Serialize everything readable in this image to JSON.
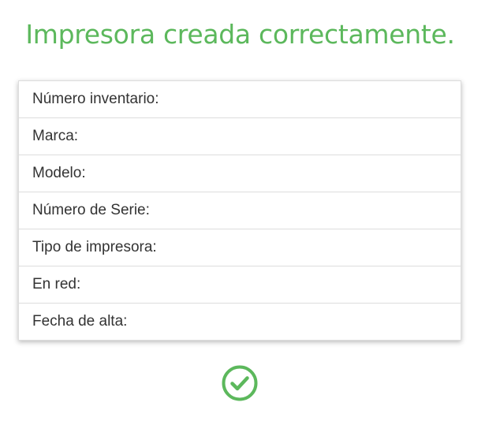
{
  "header": {
    "title": "Impresora creada correctamente."
  },
  "details": {
    "rows": [
      {
        "label": "Número inventario:",
        "value": ""
      },
      {
        "label": "Marca:",
        "value": ""
      },
      {
        "label": "Modelo:",
        "value": ""
      },
      {
        "label": "Número de Serie:",
        "value": ""
      },
      {
        "label": "Tipo de impresora:",
        "value": ""
      },
      {
        "label": "En red:",
        "value": ""
      },
      {
        "label": "Fecha de alta:",
        "value": ""
      }
    ]
  },
  "colors": {
    "success": "#5cb85c",
    "text": "#333333",
    "border": "#dddddd"
  },
  "icons": {
    "status": "check-circle-icon"
  }
}
